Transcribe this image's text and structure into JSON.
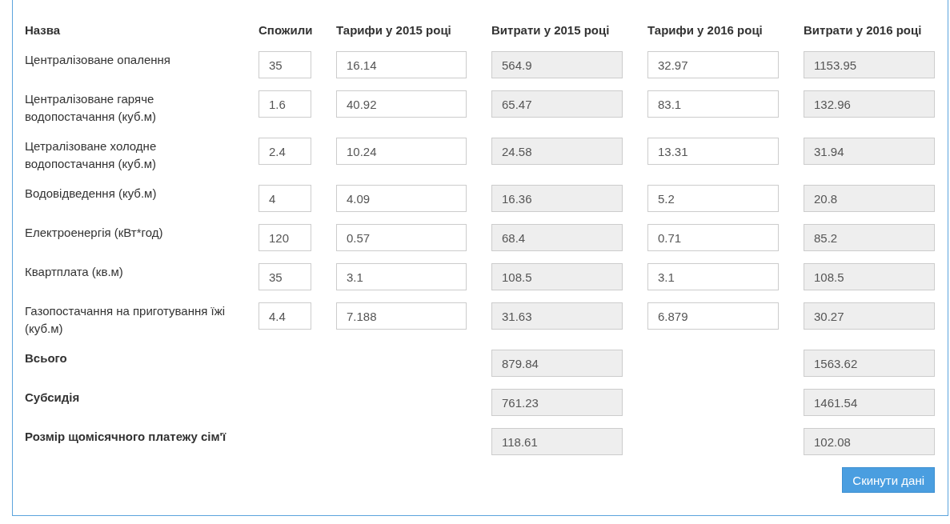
{
  "table": {
    "columns": [
      "Назва",
      "Спожили",
      "Тарифи у 2015 році",
      "Витрати у 2015 році",
      "Тарифи у 2016 році",
      "Витрати у 2016 році"
    ],
    "rows": [
      {
        "name": "Централізоване опалення",
        "consumed": "35",
        "tariff_2015": "16.14",
        "cost_2015": "564.9",
        "tariff_2016": "32.97",
        "cost_2016": "1153.95"
      },
      {
        "name": "Централізоване гаряче водопостачання (куб.м)",
        "consumed": "1.6",
        "tariff_2015": "40.92",
        "cost_2015": "65.47",
        "tariff_2016": "83.1",
        "cost_2016": "132.96"
      },
      {
        "name": "Цетралізоване холодне водопостачання (куб.м)",
        "consumed": "2.4",
        "tariff_2015": "10.24",
        "cost_2015": "24.58",
        "tariff_2016": "13.31",
        "cost_2016": "31.94"
      },
      {
        "name": "Водовідведення (куб.м)",
        "consumed": "4",
        "tariff_2015": "4.09",
        "cost_2015": "16.36",
        "tariff_2016": "5.2",
        "cost_2016": "20.8"
      },
      {
        "name": "Електроенергія (кВт*год)",
        "consumed": "120",
        "tariff_2015": "0.57",
        "cost_2015": "68.4",
        "tariff_2016": "0.71",
        "cost_2016": "85.2"
      },
      {
        "name": "Квартплата (кв.м)",
        "consumed": "35",
        "tariff_2015": "3.1",
        "cost_2015": "108.5",
        "tariff_2016": "3.1",
        "cost_2016": "108.5"
      },
      {
        "name": "Газопостачання на приготування їжі (куб.м)",
        "consumed": "4.4",
        "tariff_2015": "7.188",
        "cost_2015": "31.63",
        "tariff_2016": "6.879",
        "cost_2016": "30.27"
      }
    ],
    "totals": [
      {
        "label": "Всього",
        "cost_2015": "879.84",
        "cost_2016": "1563.62"
      },
      {
        "label": "Субсидія",
        "cost_2015": "761.23",
        "cost_2016": "1461.54"
      },
      {
        "label": "Розмір щомісячного платежу сім'ї",
        "cost_2015": "118.61",
        "cost_2016": "102.08"
      }
    ]
  },
  "reset_button": "Скинути дані"
}
